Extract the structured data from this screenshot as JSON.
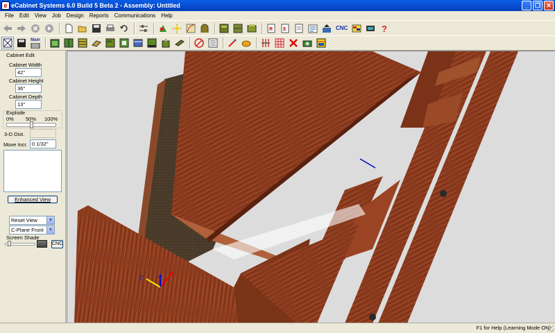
{
  "window": {
    "title": "eCabinet Systems 6.0 Build 5 Beta 2 - Assembly: Untitled"
  },
  "menu": [
    "File",
    "Edit",
    "View",
    "Job",
    "Design",
    "Reports",
    "Communications",
    "Help"
  ],
  "toolbar": {
    "cnc_label": "CNC",
    "main_label": "Main"
  },
  "panel": {
    "title": "Cabinet Edit",
    "width_label": "Cabinet Width",
    "width_value": "42\"",
    "height_label": "Cabinet Height",
    "height_value": "36\"",
    "depth_label": "Cabinet Depth",
    "depth_value": "13\"",
    "explode_label": "Explode",
    "explode_ticks": [
      "0%",
      "50%",
      "100%"
    ],
    "explode_level": 0.5,
    "dist_label": "3-D Dist.",
    "dist_value": "",
    "move_label": "Move Incr.",
    "move_value": "0 1/32\"",
    "enhanced_view_label": "Enhanced View",
    "reset_view_value": "Reset View",
    "cplane_value": "C-Plane Front",
    "screen_shade_label": "Screen Shade",
    "screen_shade_level": 0.1,
    "cnc_button_label": "CNC"
  },
  "axis": {
    "x_label": "X",
    "y_label": "Y",
    "z_label": "Z"
  },
  "colors": {
    "titlebar": "#0851d6",
    "wood": "#8a3a1e",
    "backpanel": "#4a3a2a",
    "viewport_bg": "#dcdcdc"
  },
  "status": {
    "text": "F1 for Help (Learning Mode ON)"
  }
}
